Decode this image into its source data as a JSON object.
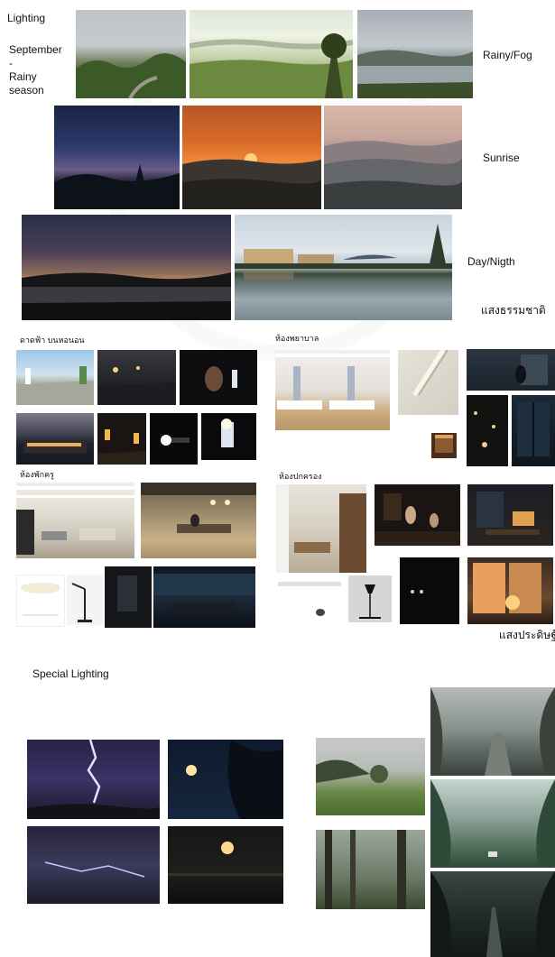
{
  "labels": {
    "lighting": "Lighting",
    "september": "September",
    "dash": "-",
    "rainy": "Rainy",
    "season": "season",
    "rainy_fog": "Rainy/Fog",
    "sunrise": "Sunrise",
    "day_night": "Day/Nigth",
    "natural_light": "แสงธรรมชาติ",
    "rooftop_bedroom": "ดาดฟ้า บนหอนอน",
    "nurse_room": "ห้องพยาบาล",
    "teacher_room": "ห้องพักครู",
    "admin_room": "ห้องปกครอง",
    "artificial_light": "แสงประดิษฐ์",
    "special_lighting": "Special Lighting"
  },
  "photo_descriptions": [
    "misty green forest hills",
    "foggy valley with pine tree",
    "misty lake",
    "blue twilight over mountains",
    "orange sunrise over hills",
    "hazy mountain ridges",
    "dusk over lake",
    "building reflected on lake",
    "rooftop terrace by day",
    "rooftop terrace at dusk",
    "face lit by phone",
    "building at night",
    "wall lanterns at night",
    "flashlight in the dark",
    "glowing phone",
    "hospital ward",
    "ceiling light slot",
    "wall lamp",
    "dark room by window",
    "night trees",
    "night window",
    "open office",
    "office meeting area",
    "principal office",
    "people in dim interior",
    "desk lamp at night",
    "ceiling light fixture",
    "desk lamp",
    "dark doorway",
    "dark office at night",
    "floor lamp",
    "dark corridor lights",
    "window at sunset",
    "lightning storm",
    "full moon behind trees",
    "lightning in clouds",
    "moon over water",
    "foggy meadow",
    "foggy forest",
    "foggy forest road",
    "misty forest with car",
    "dark forest road"
  ]
}
